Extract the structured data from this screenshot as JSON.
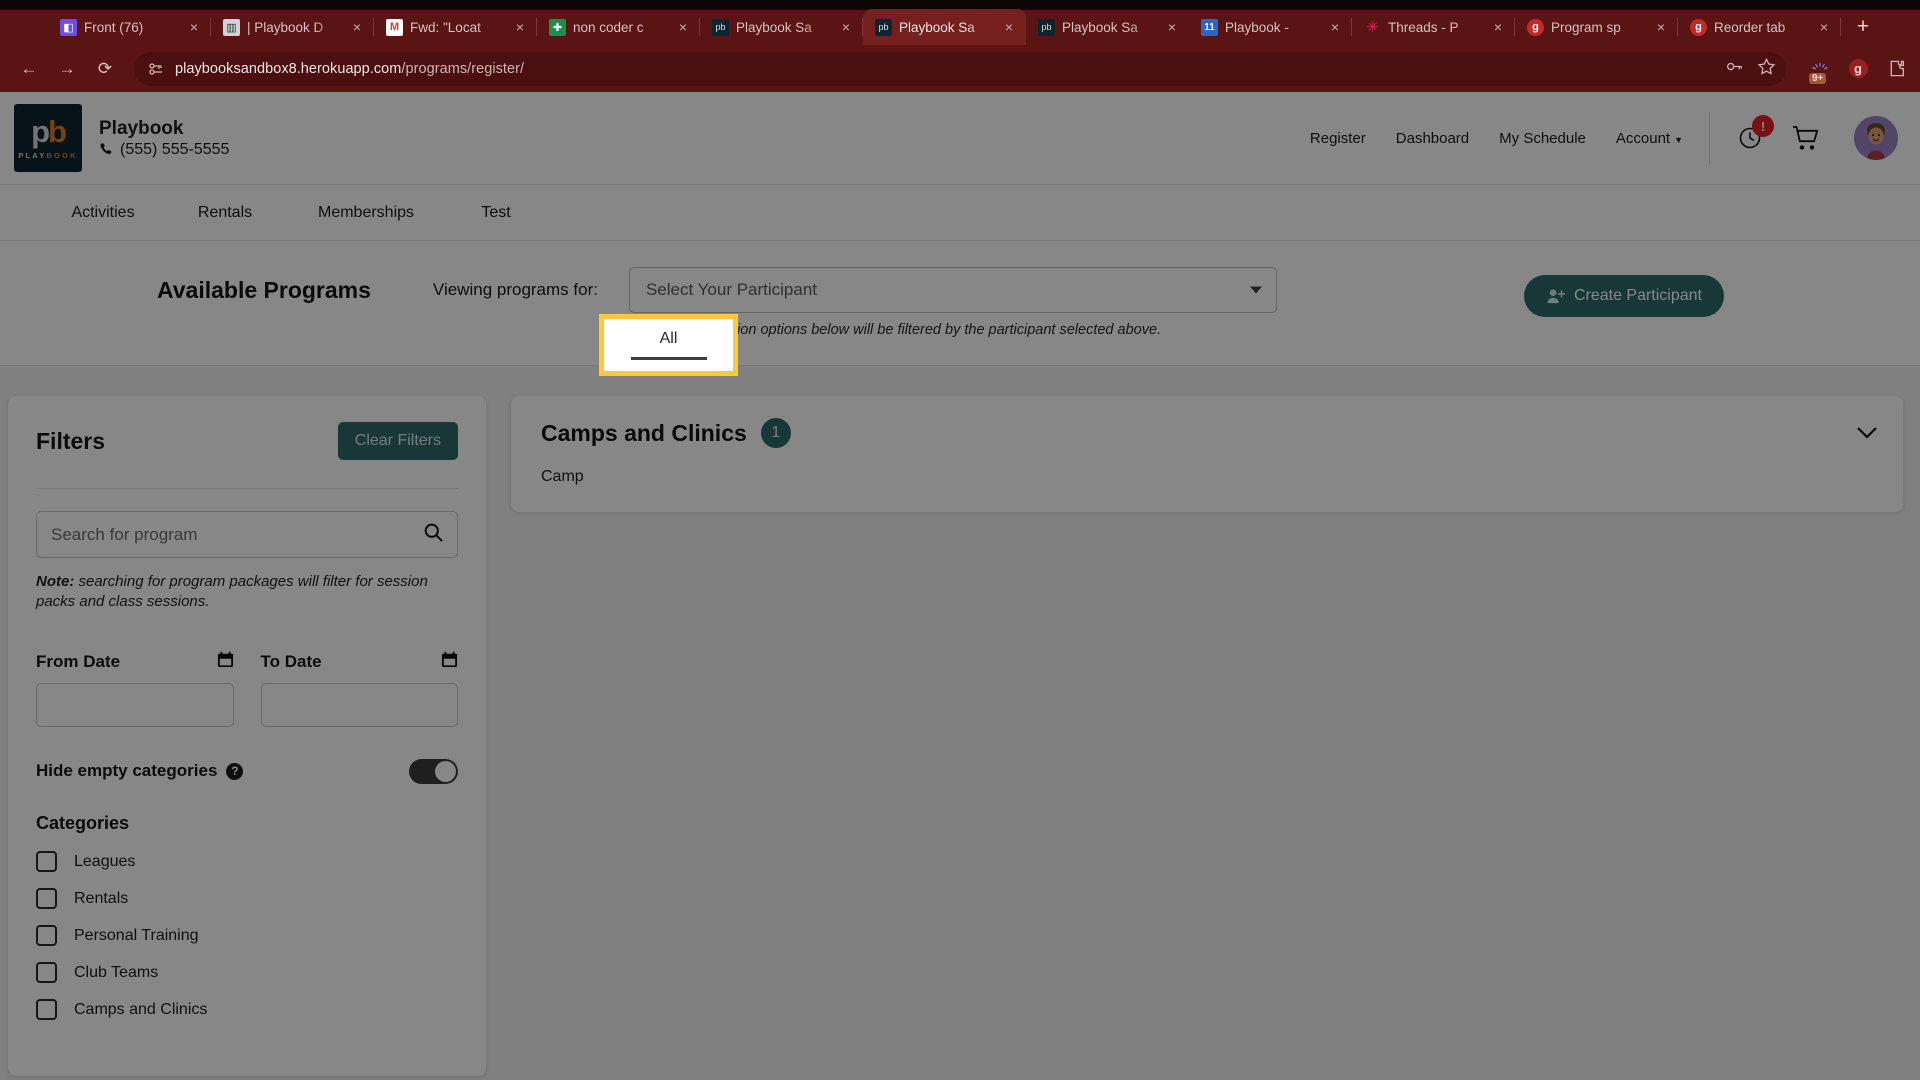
{
  "browser": {
    "tabs": [
      {
        "title": "Front (76)",
        "icon": "front-icon",
        "active": false
      },
      {
        "title": "| Playbook D",
        "icon": "playbook-doc-icon",
        "active": false
      },
      {
        "title": "Fwd: \"Locat",
        "icon": "gmail-icon",
        "active": false
      },
      {
        "title": "non coder c",
        "icon": "sheets-icon",
        "active": false
      },
      {
        "title": "Playbook Sa",
        "icon": "playbook-icon",
        "active": false
      },
      {
        "title": "Playbook Sa",
        "icon": "playbook-icon",
        "active": true
      },
      {
        "title": "Playbook Sa",
        "icon": "playbook-icon",
        "active": false
      },
      {
        "title": "Playbook - ",
        "icon": "calendar-icon",
        "active": false
      },
      {
        "title": "Threads - P",
        "icon": "slack-icon",
        "active": false
      },
      {
        "title": "Program sp",
        "icon": "grammarly-icon",
        "active": false
      },
      {
        "title": "Reorder tab",
        "icon": "grammarly-icon",
        "active": false
      }
    ],
    "new_tab_label": "+",
    "close_label": "×",
    "nav": {
      "back": "←",
      "forward": "→",
      "reload": "⟳"
    },
    "url_prefix": "playbooksandbox8.herokuapp.com",
    "url_path": "/programs/register/",
    "toolbar_icons": [
      "key-icon",
      "star-icon",
      "extension-badge-9plus",
      "grammarly-icon",
      "puzzle-icon"
    ],
    "extension_badge_count": "9+"
  },
  "site_header": {
    "logo_mark": "pb",
    "logo_wordmark_left": "PLAY",
    "logo_wordmark_right": "BOOK",
    "org_name": "Playbook",
    "phone": "(555) 555-5555",
    "nav_items": [
      {
        "label": "Register"
      },
      {
        "label": "Dashboard"
      },
      {
        "label": "My Schedule"
      },
      {
        "label": "Account",
        "has_caret": true
      }
    ],
    "alert_badge": "!",
    "icons": [
      "clock-history-icon",
      "shopping-cart-icon",
      "user-avatar"
    ]
  },
  "program_tabs": [
    {
      "label": "Activities",
      "active": false
    },
    {
      "label": "Rentals",
      "active": false
    },
    {
      "label": "Memberships",
      "active": false
    },
    {
      "label": "Test",
      "active": false
    },
    {
      "label": "All",
      "active": true,
      "highlighted": true
    }
  ],
  "available": {
    "title": "Available Programs",
    "viewing_label": "Viewing programs for:",
    "participant_placeholder": "Select Your Participant",
    "note": "Note: registration options below will be filtered by the participant selected above.",
    "create_button": "Create Participant",
    "create_icon": "person-plus-icon"
  },
  "filters": {
    "title": "Filters",
    "clear_button": "Clear Filters",
    "search_placeholder": "Search for program",
    "search_value": "",
    "search_icon": "search-icon",
    "note_bold": "Note:",
    "note_rest": " searching for program packages will filter for session packs and class sessions.",
    "from_date_label": "From Date",
    "from_date_value": "",
    "to_date_label": "To Date",
    "to_date_value": "",
    "calendar_icon": "calendar-icon",
    "hide_empty_label": "Hide empty categories",
    "hide_empty_help": "?",
    "hide_empty_on": true,
    "categories_title": "Categories",
    "categories": [
      {
        "label": "Leagues",
        "checked": false
      },
      {
        "label": "Rentals",
        "checked": false
      },
      {
        "label": "Personal Training",
        "checked": false
      },
      {
        "label": "Club Teams",
        "checked": false
      },
      {
        "label": "Camps and Clinics",
        "checked": false
      }
    ]
  },
  "results": {
    "cards": [
      {
        "title": "Camps and Clinics",
        "count": "1",
        "subtitle": "Camp",
        "chevron": "chevron-down-icon"
      }
    ]
  },
  "colors": {
    "brand_teal": "#2d6b68",
    "highlight_yellow": "#ffc83d",
    "alert_red": "#e22121",
    "browser_maroon": "#5a1414"
  }
}
